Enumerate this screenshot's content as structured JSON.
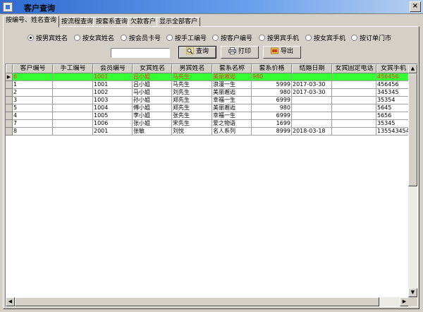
{
  "window": {
    "title": "客户查询",
    "close_glyph": "×"
  },
  "tabs": [
    "按编号、姓名查询",
    "按流程查询",
    "按套系查询",
    "欠款客户",
    "显示全部客户"
  ],
  "radios": [
    {
      "label": "按男宾姓名",
      "checked": true
    },
    {
      "label": "按女宾姓名",
      "checked": false
    },
    {
      "label": "按会员卡号",
      "checked": false
    },
    {
      "label": "按手工编号",
      "checked": false
    },
    {
      "label": "按客户编号",
      "checked": false
    },
    {
      "label": "按男宾手机",
      "checked": false
    },
    {
      "label": "按女宾手机",
      "checked": false
    },
    {
      "label": "按订单门市",
      "checked": false
    }
  ],
  "search": {
    "value": ""
  },
  "buttons": {
    "query": "查询",
    "print": "打印",
    "export": "导出"
  },
  "icons": {
    "query": "magnifier-icon",
    "print": "printer-icon",
    "export": "export-icon"
  },
  "columns": [
    "客户编号",
    "手工编号",
    "会员编号",
    "女宾姓名",
    "男宾姓名",
    "套系名称",
    "套系价格",
    "结婚日期",
    "女宾固定电话",
    "女宾手机"
  ],
  "rows": [
    [
      "6",
      "",
      "1001",
      "吕小姐",
      "马先生",
      "美丽邂逅",
      "980",
      "",
      "",
      "456456"
    ],
    [
      "1",
      "",
      "1001",
      "吕小姐",
      "马先生",
      "浪漫一生",
      "5999",
      "2017-03-30",
      "",
      "456456"
    ],
    [
      "2",
      "",
      "1002",
      "马小姐",
      "刘先生",
      "美丽邂逅",
      "980",
      "2017-03-30",
      "",
      "345345"
    ],
    [
      "3",
      "",
      "1003",
      "孙小姐",
      "郑先生",
      "幸福一生",
      "6999",
      "",
      "",
      "35354"
    ],
    [
      "5",
      "",
      "1004",
      "傅小姐",
      "郑先生",
      "美丽邂逅",
      "980",
      "",
      "",
      "5645"
    ],
    [
      "4",
      "",
      "1005",
      "李小姐",
      "张先生",
      "幸福一生",
      "6999",
      "",
      "",
      "5656"
    ],
    [
      "7",
      "",
      "1006",
      "张小姐",
      "宋先生",
      "爱之物语",
      "1699",
      "",
      "",
      "35345"
    ],
    [
      "8",
      "",
      "2001",
      "张敏",
      "刘悦",
      "名人系列",
      "8999",
      "2018-03-18",
      "",
      "13554345433"
    ]
  ],
  "selected_row": 0,
  "colors": {
    "selected_bg": "#33ff33",
    "selected_text": "#ff3030"
  }
}
